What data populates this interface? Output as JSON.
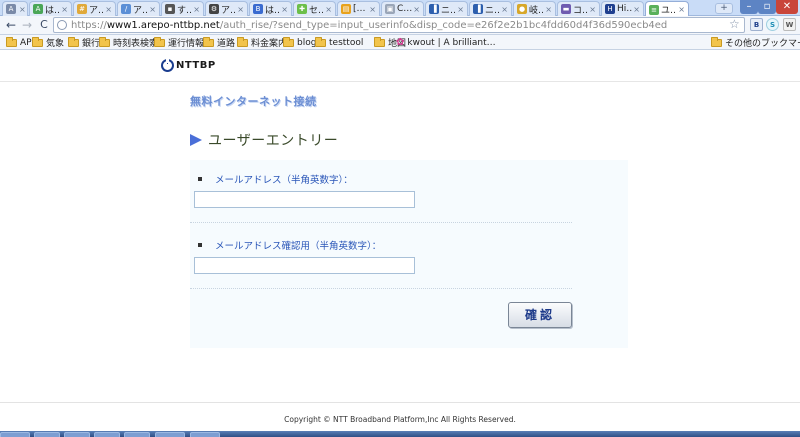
{
  "browser": {
    "tabs": [
      {
        "title": "は…",
        "favicon_color": "#7a8aa8",
        "glyph": "A",
        "active": false
      },
      {
        "title": "は…",
        "favicon_color": "#4aa657",
        "glyph": "A",
        "active": false
      },
      {
        "title": "ア…",
        "favicon_color": "#e0a93a",
        "glyph": "#",
        "active": false
      },
      {
        "title": "ア…",
        "favicon_color": "#5b8fd6",
        "glyph": "/",
        "active": false
      },
      {
        "title": "す…",
        "favicon_color": "#555555",
        "glyph": "▪",
        "active": false
      },
      {
        "title": "ア…",
        "favicon_color": "#444444",
        "glyph": "⚙",
        "active": false
      },
      {
        "title": "は…",
        "favicon_color": "#3a6bd0",
        "glyph": "B",
        "active": false
      },
      {
        "title": "セ…",
        "favicon_color": "#6cbf4a",
        "glyph": "✚",
        "active": false
      },
      {
        "title": "[…",
        "favicon_color": "#e8a21c",
        "glyph": "▤",
        "active": false
      },
      {
        "title": "C…",
        "favicon_color": "#9aa6b8",
        "glyph": "▣",
        "active": false
      },
      {
        "title": "ニ…",
        "favicon_color": "#2d5fae",
        "glyph": "▐",
        "active": false
      },
      {
        "title": "ニ…",
        "favicon_color": "#2d5fae",
        "glyph": "▐",
        "active": false
      },
      {
        "title": "岐…",
        "favicon_color": "#d7a72a",
        "glyph": "●",
        "active": false
      },
      {
        "title": "コ…",
        "favicon_color": "#6f5bb0",
        "glyph": "▬",
        "active": false
      },
      {
        "title": "Hi…",
        "favicon_color": "#1f3f8f",
        "glyph": "H",
        "active": false
      },
      {
        "title": "ユ…",
        "favicon_color": "#5ab05a",
        "glyph": "≡",
        "active": true
      }
    ],
    "new_tab_label": "+",
    "window_buttons": {
      "minimize": "–",
      "maximize": "▫",
      "close": "✕"
    },
    "url": {
      "scheme": "https://",
      "host": "www1.arepo-nttbp.net",
      "path": "/auth_rise/?send_type=input_userinfo&disp_code=e26f2e2b1bc4fdd60d4f36d590ecb4ed"
    },
    "nav": {
      "back": "←",
      "forward": "→",
      "reload": "C",
      "star": "☆"
    },
    "extensions": [
      "B",
      "S",
      "W"
    ],
    "bookmarks": [
      {
        "label": "AP",
        "type": "folder"
      },
      {
        "label": "気象",
        "type": "folder"
      },
      {
        "label": "銀行",
        "type": "folder"
      },
      {
        "label": "時刻表検索",
        "type": "folder"
      },
      {
        "label": "運行情報",
        "type": "folder"
      },
      {
        "label": "道路",
        "type": "folder"
      },
      {
        "label": "料金案内",
        "type": "folder"
      },
      {
        "label": "blog",
        "type": "folder"
      },
      {
        "label": "testtool",
        "type": "folder"
      },
      {
        "label": "地図",
        "type": "folder"
      },
      {
        "label": "kwout | A brilliant…",
        "type": "link"
      }
    ],
    "other_bookmarks": "その他のブックマーク"
  },
  "page": {
    "logo_text": "NTTBP",
    "free_title": "無料インターネット接続",
    "section_title": "ユーザーエントリー",
    "fields": [
      {
        "label": "メールアドレス（半角英数字）：",
        "value": "",
        "placeholder": ""
      },
      {
        "label": "メールアドレス確認用（半角英数字）：",
        "value": "",
        "placeholder": ""
      }
    ],
    "confirm_button": "確認",
    "copyright": "Copyright © NTT Broadband Platform,Inc All Rights Reserved."
  },
  "colors": {
    "accent_blue": "#2a56b8",
    "title_blue": "#6d8fd3",
    "form_bg": "#f6fbfe",
    "button_text": "#1d3a8a"
  }
}
